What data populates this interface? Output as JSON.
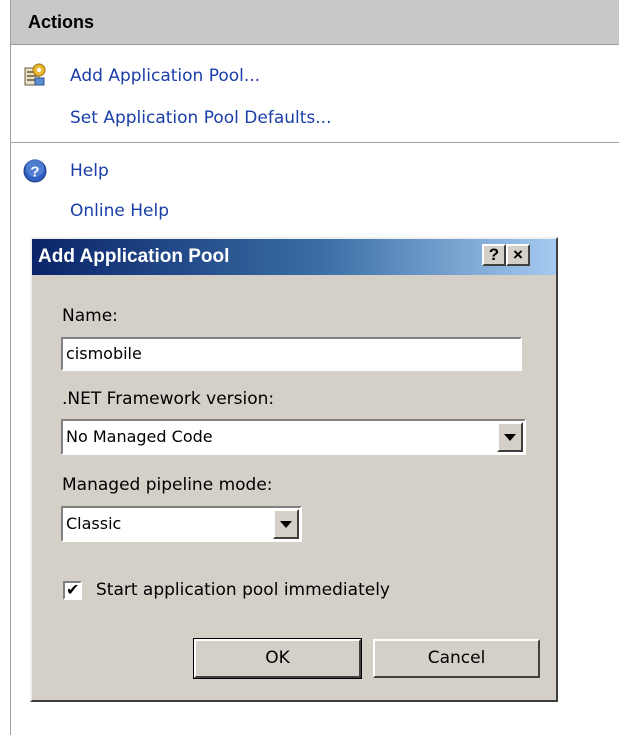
{
  "actions": {
    "title": "Actions",
    "add_pool": "Add Application Pool...",
    "set_defaults": "Set Application Pool Defaults...",
    "help": "Help",
    "online_help": "Online Help",
    "icons": [
      "application-pool-icon",
      "help-icon"
    ]
  },
  "dialog": {
    "title": "Add Application Pool",
    "help_button": "?",
    "close_button": "×",
    "name_label": "Name:",
    "name_value": "cismobile",
    "framework_label": ".NET Framework version:",
    "framework_value": "No Managed Code",
    "pipeline_label": "Managed pipeline mode:",
    "pipeline_value": "Classic",
    "start_checkbox_label": "Start application pool immediately",
    "start_checked": true,
    "ok_label": "OK",
    "cancel_label": "Cancel"
  },
  "colors": {
    "link": "#1a3ea8",
    "titlebar_start": "#0a246a",
    "titlebar_end": "#a6caf0",
    "dialog_face": "#d4d0c8"
  }
}
